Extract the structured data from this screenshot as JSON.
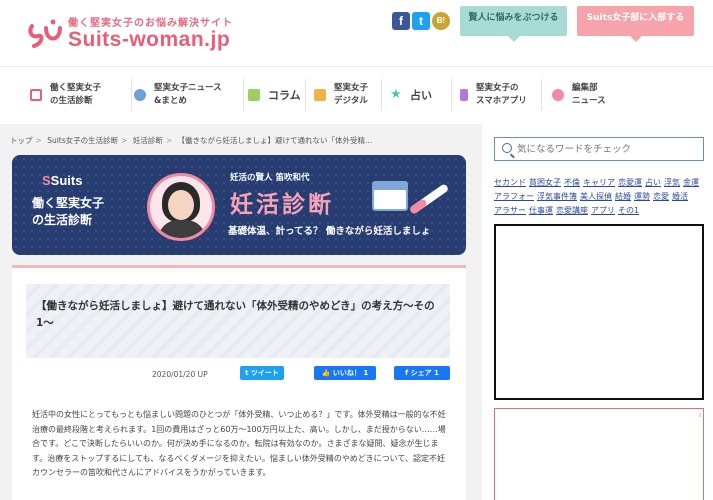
{
  "header": {
    "tagline": "働く堅実女子のお悩み解決サイト",
    "logo_main": "Suits",
    "logo_sub": "-woman.jp",
    "ask_button": "賢人に悩みをぶつける",
    "join_button": "Suits女子部に入部する",
    "social": {
      "facebook": "f",
      "twitter": "t",
      "hatena": "B!"
    }
  },
  "nav": [
    {
      "label": "働く堅実女子\nの生活診断",
      "icon_color": "#e95d77",
      "icon": "clipboard-icon"
    },
    {
      "label": "堅実女子ニュース\n&まとめ",
      "icon_color": "#6fa0d8",
      "icon": "pen-icon"
    },
    {
      "label": "コラム",
      "icon_color": "#9ccf5f",
      "icon": "book-icon"
    },
    {
      "label": "堅実女子\nデジタル",
      "icon_color": "#f2b24a",
      "icon": "bag-icon"
    },
    {
      "label": "占い",
      "icon_color": "#4fc2b6",
      "icon": "star-icon"
    },
    {
      "label": "堅実女子の\nスマホアプリ",
      "icon_color": "#b07ad8",
      "icon": "phone-icon"
    },
    {
      "label": "編集部\nニュース",
      "icon_color": "#f28aa3",
      "icon": "speech-icon"
    }
  ],
  "breadcrumb": [
    "トップ",
    "Suits女子の生活診断",
    "妊活診断",
    "【働きながら妊活しましょ】避けて通れない「体外受精..."
  ],
  "banner": {
    "brand": "Suits",
    "subtitle": "働く堅実女子\nの生活診断",
    "byline": "妊活の賢人 笛吹和代",
    "title": "妊活診断",
    "catch": "基礎体温、計ってる？ 働きながら妊活しましょ"
  },
  "article": {
    "title": "【働きながら妊活しましょ】避けて通れない「体外受精のやめどき」の考え方〜その1〜",
    "date": "2020/01/20 UP",
    "tweet": "ツイート",
    "like": "いいね！ 1",
    "share": "シェア 1",
    "body": "妊活中の女性にとってもっとも悩ましい問題のひとつが「体外受精、いつ止める？」です。体外受精は一般的な不妊治療の最終段階と考えられます。1回の費用はざっと60万〜100万円以上た、高い。しかし、まだ授からない……場合です。どこで決断したらいいのか。何が決め手になるのか。転院は有効なのか。さまざまな疑問、疑念が生じます。治療をストップするにしても、なるべくダメージを抑えたい。悩ましい体外受精のやめどきについて、認定不妊カウンセラーの笛吹和代さんにアドバイスをうかがっていきます。"
  },
  "sidebar": {
    "search_placeholder": "気になるワードをチェック",
    "tags": [
      "セカンド",
      "貧困女子",
      "不倫",
      "キャリア",
      "恋愛運",
      "占い",
      "浮気",
      "金運",
      "アラフォー",
      "浮気事件簿",
      "美人探偵",
      "結婚",
      "運勢",
      "恋愛",
      "婚活",
      "アラサー",
      "仕事運",
      "恋愛講座",
      "アプリ",
      "その1"
    ],
    "ad_mark": "i"
  },
  "colors": {
    "brand_pink": "#e95d77",
    "banner_navy": "#273c70",
    "link_blue": "#2b4a9a"
  }
}
